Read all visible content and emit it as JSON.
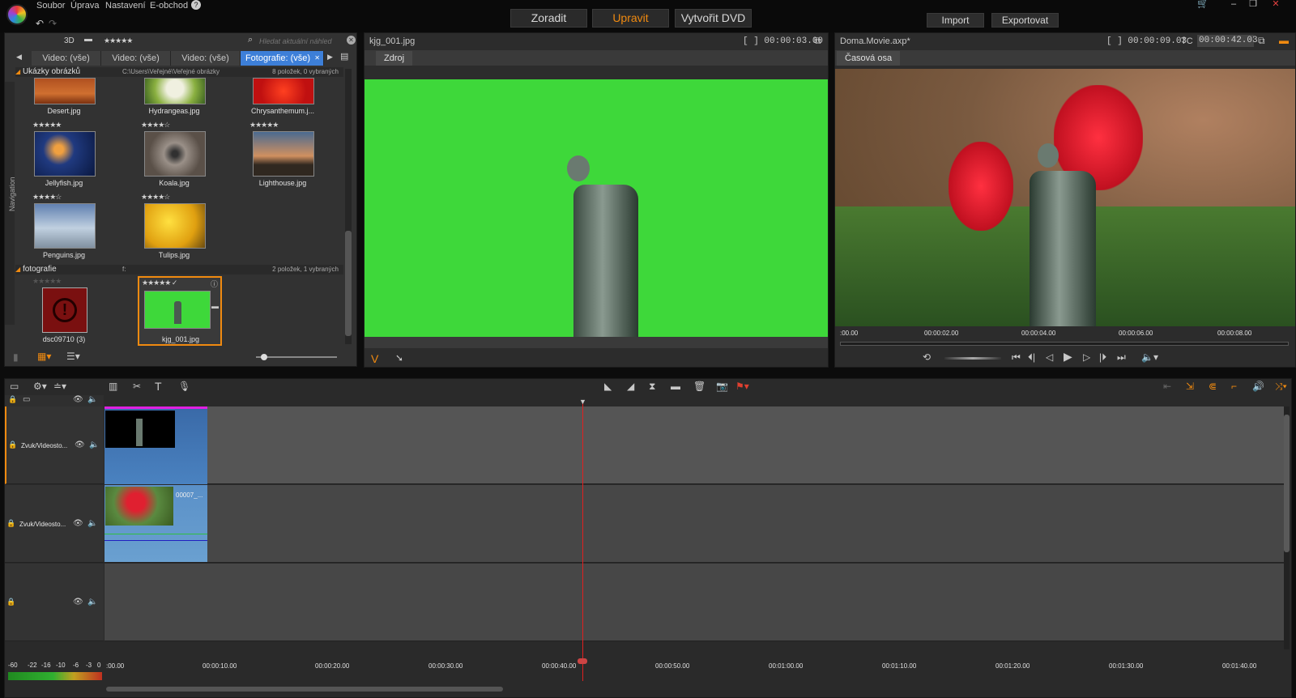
{
  "menu": [
    "Soubor",
    "Úprava",
    "Nastavení",
    "E-obchod"
  ],
  "modes": [
    "Zoradit",
    "Upravit",
    "Vytvořit DVD"
  ],
  "active_mode": "Upravit",
  "top_buttons": [
    "Import",
    "Exportovat"
  ],
  "library": {
    "mode_3d": "3D",
    "rating": "★★★★★",
    "search_placeholder": "Hledat aktuální náhled",
    "tabs": [
      "Video: (vše)",
      "Video: (vše)",
      "Video: (vše)",
      "Fotografie: (vše)"
    ],
    "nav_label": "Navigation",
    "section1": {
      "title": "Ukázky obrázků",
      "path": "C:\\Users\\Veřejné\\Veřejné obrázky",
      "count": "8 položek, 0 vybraných"
    },
    "section2": {
      "title": "fotografie",
      "path": "f:",
      "count": "2 položek, 1 vybraných"
    },
    "items": [
      {
        "name": "Desert.jpg"
      },
      {
        "name": "Hydrangeas.jpg"
      },
      {
        "name": "Chrysanthemum.j..."
      },
      {
        "name": "Jellyfish.jpg",
        "stars": "★★★★★"
      },
      {
        "name": "Koala.jpg",
        "stars": "★★★★☆"
      },
      {
        "name": "Lighthouse.jpg",
        "stars": "★★★★★"
      },
      {
        "name": "Penguins.jpg",
        "stars": "★★★★☆"
      },
      {
        "name": "Tulips.jpg",
        "stars": "★★★★☆"
      },
      {
        "name": "dsc09710 (3)",
        "stars": "★★★★★"
      },
      {
        "name": "kjg_001.jpg",
        "stars": "★★★★★ ✓"
      }
    ]
  },
  "source": {
    "title": "kjg_001.jpg",
    "timecode": "[ ] 00:00:03.00",
    "tab": "Zdroj"
  },
  "player": {
    "title": "Doma.Movie.axp*",
    "timecode": "[ ] 00:00:09.03",
    "tc_label": "TC",
    "tc_value": "00:00:42.03",
    "tab": "Časová osa",
    "ruler": [
      ":00.00",
      "00:00:02.00",
      "00:00:04.00",
      "00:00:06.00",
      "00:00:08.00"
    ]
  },
  "timeline": {
    "tracks": [
      "Zvuk/Videosto...",
      "Zvuk/Videosto..."
    ],
    "clip_label": "00007_...",
    "ruler": [
      ":00.00",
      "00:00:10.00",
      "00:00:20.00",
      "00:00:30.00",
      "00:00:40.00",
      "00:00:50.00",
      "00:01:00.00",
      "00:01:10.00",
      "00:01:20.00",
      "00:01:30.00",
      "00:01:40.00"
    ],
    "meter": [
      "-60",
      "-22",
      "-16",
      "-10",
      "-6",
      "-3",
      "0"
    ]
  },
  "colors": {
    "accent": "#f08a10",
    "tab_active": "#3d7fd8",
    "chroma_green": "#3ed83a"
  }
}
